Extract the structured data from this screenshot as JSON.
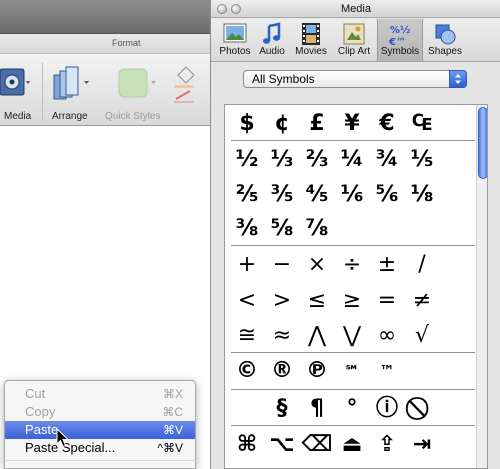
{
  "app": {
    "ribbon_group_title": "Format",
    "buttons": [
      {
        "name": "media-button",
        "label": "Media"
      },
      {
        "name": "arrange-button",
        "label": "Arrange"
      },
      {
        "name": "quick-styles-button",
        "label": "Quick Styles"
      }
    ]
  },
  "context_menu": {
    "items": [
      {
        "label": "Cut",
        "shortcut": "⌘X",
        "enabled": false
      },
      {
        "label": "Copy",
        "shortcut": "⌘C",
        "enabled": false
      },
      {
        "label": "Paste",
        "shortcut": "⌘V",
        "enabled": true,
        "highlighted": true
      },
      {
        "label": "Paste Special...",
        "shortcut": "^⌘V",
        "enabled": true
      }
    ]
  },
  "palette": {
    "title": "Media",
    "tabs": [
      {
        "label": "Photos",
        "icon": "photos-icon"
      },
      {
        "label": "Audio",
        "icon": "audio-note-icon"
      },
      {
        "label": "Movies",
        "icon": "film-strip-icon"
      },
      {
        "label": "Clip Art",
        "icon": "clip-art-icon"
      },
      {
        "label": "Symbols",
        "icon": "symbols-icon",
        "active": true
      },
      {
        "label": "Shapes",
        "icon": "shapes-icon"
      }
    ],
    "category": "All Symbols",
    "symbol_rows": [
      [
        "$",
        "¢",
        "£",
        "¥",
        "€",
        "₠"
      ],
      [
        "½",
        "⅓",
        "⅔",
        "¼",
        "¾",
        "⅕"
      ],
      [
        "⅖",
        "⅗",
        "⅘",
        "⅙",
        "⅚",
        "⅛"
      ],
      [
        "⅜",
        "⅝",
        "⅞"
      ],
      [
        "+",
        "−",
        "×",
        "÷",
        "±",
        "/"
      ],
      [
        "<",
        ">",
        "≤",
        "≥",
        "=",
        "≠"
      ],
      [
        "≅",
        "≈",
        "⋀",
        "⋁",
        "∞",
        "√"
      ],
      [
        "©",
        "®",
        "℗",
        "℠",
        "™"
      ],
      [
        "",
        "§",
        "¶",
        "°",
        "ⓘ",
        "⃠"
      ],
      [
        "⌘",
        "⌥",
        "⌫",
        "⏏",
        "⇪",
        "⇥"
      ]
    ]
  }
}
